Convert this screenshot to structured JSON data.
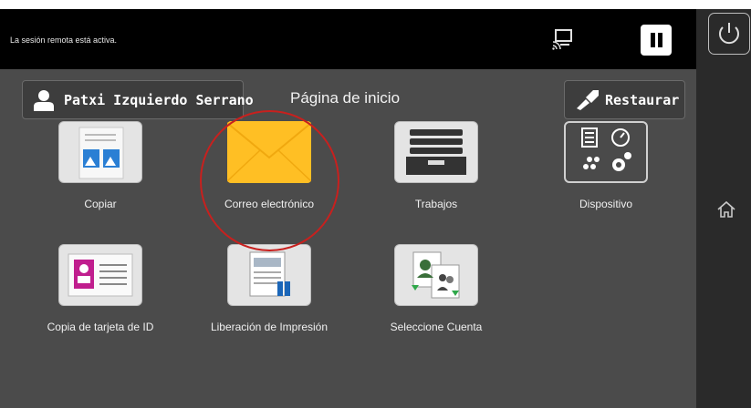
{
  "status_bar": {
    "message": "La sesión remota está activa."
  },
  "header": {
    "user_label": "Patxi Izquierdo Serrano",
    "title": "Página de inicio",
    "restore_label": "Restaurar"
  },
  "apps": [
    {
      "label": "Copiar"
    },
    {
      "label": "Correo electrónico"
    },
    {
      "label": "Trabajos"
    },
    {
      "label": "Dispositivo"
    },
    {
      "label": "Copia de tarjeta de ID"
    },
    {
      "label": "Liberación de Impresión"
    },
    {
      "label": "Seleccione Cuenta"
    }
  ],
  "colors": {
    "highlight": "#c8201e",
    "email_tile": "#ffbf24",
    "background": "#4b4b4b"
  }
}
